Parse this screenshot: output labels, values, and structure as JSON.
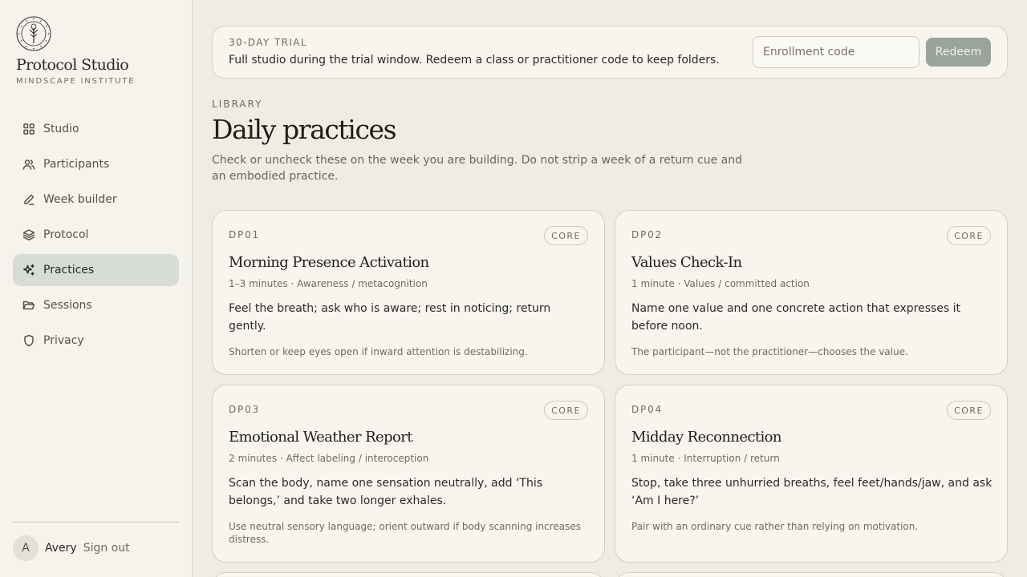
{
  "brand": {
    "title": "Protocol Studio",
    "subtitle": "MINDSCAPE INSTITUTE",
    "logo_icon": "tree-seal-icon"
  },
  "nav": [
    {
      "label": "Studio",
      "icon": "grid-icon"
    },
    {
      "label": "Participants",
      "icon": "users-icon"
    },
    {
      "label": "Week builder",
      "icon": "pencil-icon"
    },
    {
      "label": "Protocol",
      "icon": "layers-icon"
    },
    {
      "label": "Practices",
      "icon": "sparkle-icon",
      "active": true
    },
    {
      "label": "Sessions",
      "icon": "folder-open-icon"
    },
    {
      "label": "Privacy",
      "icon": "shield-icon"
    }
  ],
  "user": {
    "initial": "A",
    "name": "Avery",
    "signout": "Sign out"
  },
  "trial": {
    "label": "30-DAY TRIAL",
    "text": "Full studio during the trial window. Redeem a class or practitioner code to keep folders.",
    "input_placeholder": "Enrollment code",
    "input_value": "",
    "button": "Redeem"
  },
  "page": {
    "eyebrow": "LIBRARY",
    "title": "Daily practices",
    "description": "Check or uncheck these on the week you are building. Do not strip a week of a return cue and an embodied practice."
  },
  "practices": [
    {
      "id": "DP01",
      "badge": "CORE",
      "title": "Morning Presence Activation",
      "meta": "1–3 minutes · Awareness / metacognition",
      "body": "Feel the breath; ask who is aware; rest in noticing; return gently.",
      "note": "Shorten or keep eyes open if inward attention is destabilizing."
    },
    {
      "id": "DP02",
      "badge": "CORE",
      "title": "Values Check-In",
      "meta": "1 minute · Values / committed action",
      "body": "Name one value and one concrete action that expresses it before noon.",
      "note": "The participant—not the practitioner—chooses the value."
    },
    {
      "id": "DP03",
      "badge": "CORE",
      "title": "Emotional Weather Report",
      "meta": "2 minutes · Affect labeling / interoception",
      "body": "Scan the body, name one sensation neutrally, add ‘This belongs,’ and take two longer exhales.",
      "note": "Use neutral sensory language; orient outward if body scanning increases distress."
    },
    {
      "id": "DP04",
      "badge": "CORE",
      "title": "Midday Reconnection",
      "meta": "1 minute · Interruption / return",
      "body": "Stop, take three unhurried breaths, feel feet/hands/jaw, and ask ‘Am I here?’",
      "note": "Pair with an ordinary cue rather than relying on motivation."
    }
  ]
}
